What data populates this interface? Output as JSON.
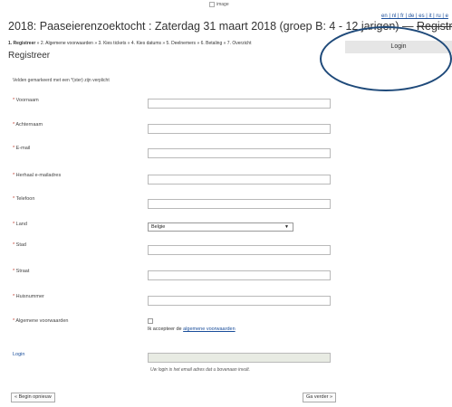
{
  "header": {
    "image_alt": "image",
    "languages": "en | nl | fr | de | es | it | ru | e",
    "title_main": "2018: Paaseierenzoektocht : Zaterdag 31 maart 2018 (groep B: 4 - 12 jarigen) — ",
    "title_strike": "Registreer"
  },
  "steps": {
    "current": "1. Registreer",
    "rest": " » 2. Algemene voorwaarden » 3. Kies tickets » 4. Kies datums » 5. Deelnemers » 6. Betaling » 7. Overzicht"
  },
  "page_heading": "Registreer",
  "login_box": "Login",
  "required_note": "Velden gemarkeerd met een *(ster) zijn verplicht",
  "fields": {
    "voornaam": "Voornaam",
    "achternaam": "Achternaam",
    "email": "E-mail",
    "herhaal_email": "Herhaal e-mailadres",
    "telefoon": "Telefoon",
    "land": "Land",
    "stad": "Stad",
    "straat": "Straat",
    "huisnummer": "Huisnummer",
    "voorwaarden": "Algemene voorwaarden"
  },
  "required_marker": "*",
  "land_value": "Belgie",
  "accept_prefix": "Ik accepteer de ",
  "accept_link": "algemene voorwaarden",
  "login": {
    "label": "Login",
    "hint": "Uw login is het email adres dat u bovenaan invult."
  },
  "buttons": {
    "restart": "« Begin opnieuw",
    "next": "Ga verder »"
  }
}
